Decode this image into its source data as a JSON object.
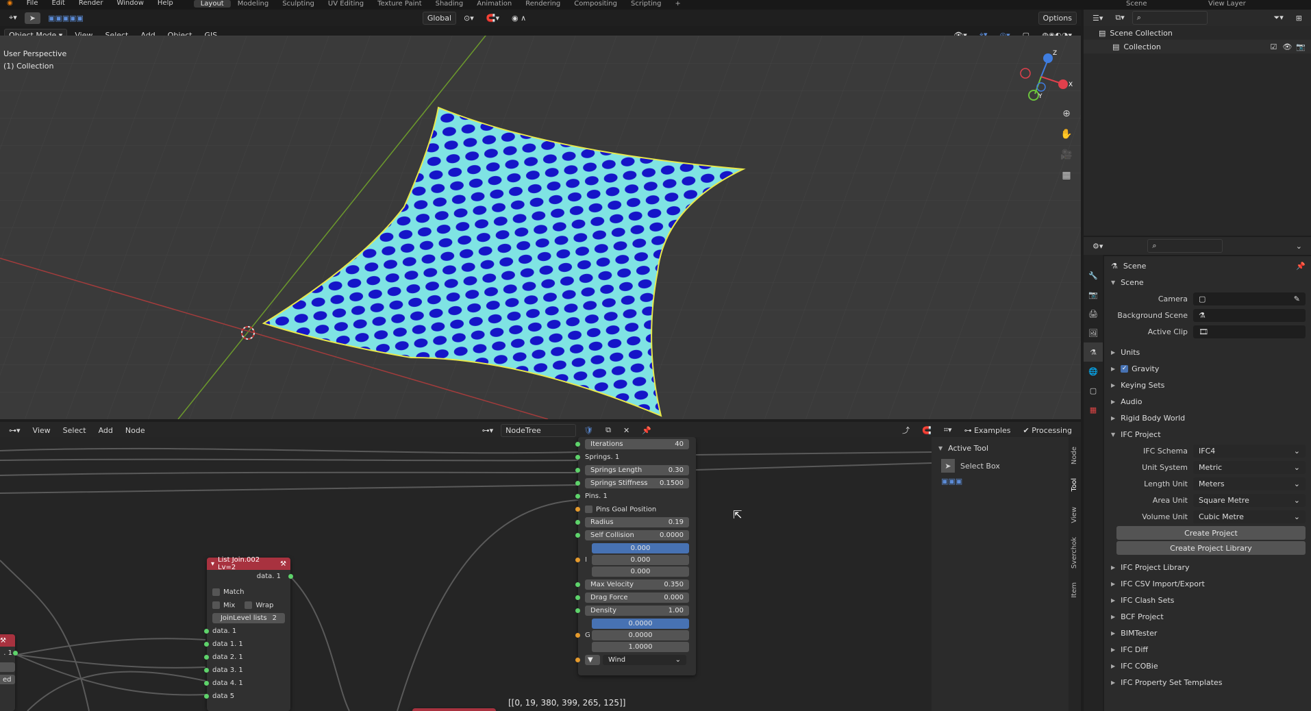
{
  "menu": [
    "File",
    "Edit",
    "Render",
    "Window",
    "Help"
  ],
  "workspaces": [
    "Layout",
    "Modeling",
    "Sculpting",
    "UV Editing",
    "Texture Paint",
    "Shading",
    "Animation",
    "Rendering",
    "Compositing",
    "Scripting"
  ],
  "active_workspace": "Layout",
  "scene_name": "Scene",
  "view_layer": "View Layer",
  "viewport_header": {
    "mode": "Object Mode",
    "menus": [
      "View",
      "Select",
      "Add",
      "Object",
      "GIS"
    ],
    "transform": "Global",
    "options": "Options"
  },
  "viewport": {
    "perspective": "User Perspective",
    "collection": "(1) Collection"
  },
  "gizmo": {
    "x": "X",
    "y": "Y",
    "z": "Z"
  },
  "node_header": {
    "menus": [
      "View",
      "Select",
      "Add",
      "Node"
    ],
    "tree_name": "NodeTree",
    "examples": "Examples",
    "processing": "Processing"
  },
  "node_main": {
    "rows": [
      {
        "label": "Iterations",
        "value": "40"
      },
      {
        "label": "Springs. 1",
        "value": ""
      },
      {
        "label": "Springs Length",
        "value": "0.30"
      },
      {
        "label": "Springs Stiffness",
        "value": "0.1500"
      },
      {
        "label": "Pins. 1",
        "value": ""
      },
      {
        "label": "Pins Goal Position",
        "value": ""
      },
      {
        "label": "Radius",
        "value": "0.19"
      },
      {
        "label": "Self Collision",
        "value": "0.0000"
      }
    ],
    "vector1": [
      "0.000",
      "0.000",
      "0.000"
    ],
    "vector1_label": "I",
    "rows2": [
      {
        "label": "Max Velocity",
        "value": "0.350"
      },
      {
        "label": "Drag Force",
        "value": "0.000"
      },
      {
        "label": "Density",
        "value": "1.00"
      }
    ],
    "vector2": [
      "0.0000",
      "0.0000",
      "1.0000"
    ],
    "vector2_label": "G",
    "wind": "Wind"
  },
  "list_join": {
    "title": "List Join.002 Lv=2",
    "out": "data. 1",
    "match": "Match",
    "mix": "Mix",
    "wrap": "Wrap",
    "join_level_label": "JoinLevel lists",
    "join_level": "2",
    "inputs": [
      "data. 1",
      "data 1. 1",
      "data 2. 1",
      "data 3. 1",
      "data 4. 1",
      "data 5"
    ]
  },
  "left_node": {
    "out": ". 1",
    "fields": [
      "",
      "ed"
    ]
  },
  "viewer_text": "[[0, 19, 380, 399, 265, 125]]",
  "node_sidebar": {
    "title": "Active Tool",
    "tool": "Select Box",
    "tabs": [
      "Node",
      "Tool",
      "View",
      "Sverchok",
      "Item"
    ]
  },
  "outliner": {
    "root": "Scene Collection",
    "child": "Collection"
  },
  "properties": {
    "title": "Scene",
    "section": "Scene",
    "fields": [
      {
        "label": "Camera",
        "value": ""
      },
      {
        "label": "Background Scene",
        "value": ""
      },
      {
        "label": "Active Clip",
        "value": ""
      }
    ],
    "collapsed1": [
      "Units"
    ],
    "gravity": "Gravity",
    "collapsed2": [
      "Keying Sets",
      "Audio",
      "Rigid Body World"
    ],
    "ifc_project": "IFC Project",
    "ifc_fields": [
      {
        "label": "IFC Schema",
        "value": "IFC4"
      },
      {
        "label": "Unit System",
        "value": "Metric"
      },
      {
        "label": "Length Unit",
        "value": "Meters"
      },
      {
        "label": "Area Unit",
        "value": "Square Metre"
      },
      {
        "label": "Volume Unit",
        "value": "Cubic Metre"
      }
    ],
    "buttons": [
      "Create Project",
      "Create Project Library"
    ],
    "sections": [
      "IFC Project Library",
      "IFC CSV Import/Export",
      "IFC Clash Sets",
      "BCF Project",
      "BIMTester",
      "IFC Diff",
      "IFC COBie",
      "IFC Property Set Templates"
    ]
  },
  "colors": {
    "mesh_fill": "#1515c8",
    "mesh_edge": "#7fe3e3",
    "accent": "#4772b3",
    "node_header": "#a8323f",
    "socket": "#5ed36b"
  }
}
